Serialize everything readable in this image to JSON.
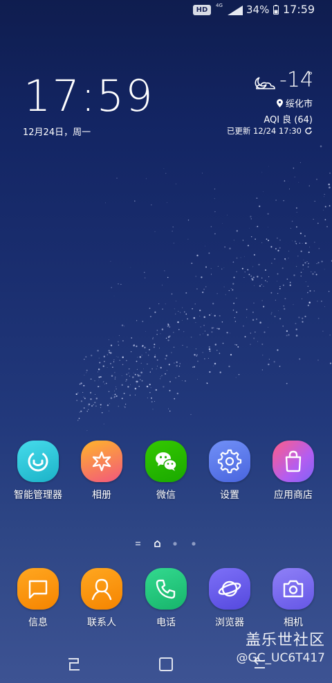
{
  "status_bar": {
    "hd_badge": "HD",
    "network_type": "4G",
    "battery_percent": "34%",
    "time": "17:59"
  },
  "clock": {
    "time": "17:59",
    "date": "12月24日，周一"
  },
  "weather": {
    "temperature": "-14",
    "degree": "°",
    "location": "绥化市",
    "aqi": "AQI 良 (64)",
    "updated": "已更新 12/24 17:30"
  },
  "apps": [
    {
      "label": "智能管理器",
      "icon": "device-care-icon",
      "color_from": "#3fd6e8",
      "color_to": "#1fb4c9"
    },
    {
      "label": "相册",
      "icon": "gallery-icon",
      "color_from": "#ffb22e",
      "color_to": "#f25b7a"
    },
    {
      "label": "微信",
      "icon": "wechat-icon",
      "color_from": "#2dc100",
      "color_to": "#1fad00"
    },
    {
      "label": "设置",
      "icon": "settings-gear-icon",
      "color_from": "#6b8cf5",
      "color_to": "#4d68e0"
    },
    {
      "label": "应用商店",
      "icon": "galaxy-store-icon",
      "color_from": "#ff5f88",
      "color_to": "#8c5cf5"
    }
  ],
  "dock": [
    {
      "label": "信息",
      "icon": "messages-icon",
      "color_from": "#ffa31f",
      "color_to": "#f08a00"
    },
    {
      "label": "联系人",
      "icon": "contacts-icon",
      "color_from": "#ffa31f",
      "color_to": "#f58700"
    },
    {
      "label": "电话",
      "icon": "phone-icon",
      "color_from": "#2ed58a",
      "color_to": "#1cb86f"
    },
    {
      "label": "浏览器",
      "icon": "internet-browser-icon",
      "color_from": "#7a6cf5",
      "color_to": "#5a4fe0"
    },
    {
      "label": "相机",
      "icon": "camera-icon",
      "color_from": "#8a7cf5",
      "color_to": "#6a5ce8"
    }
  ],
  "page_indicator": {
    "pages": 3,
    "current": 1
  },
  "watermark": {
    "brand": "盖乐世社区",
    "user": "@GC_UC6T417"
  }
}
